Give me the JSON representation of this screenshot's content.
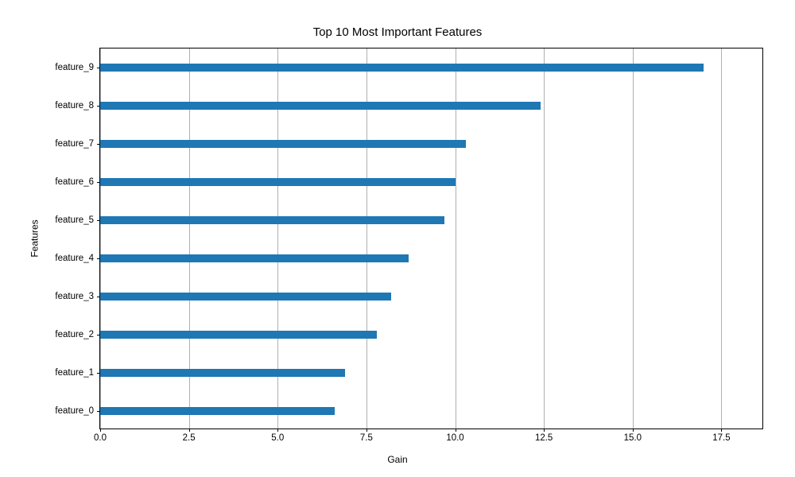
{
  "chart_data": {
    "type": "bar",
    "orientation": "horizontal",
    "title": "Top 10 Most Important Features",
    "xlabel": "Gain",
    "ylabel": "Features",
    "categories": [
      "feature_0",
      "feature_1",
      "feature_2",
      "feature_3",
      "feature_4",
      "feature_5",
      "feature_6",
      "feature_7",
      "feature_8",
      "feature_9"
    ],
    "values": [
      6.6,
      6.9,
      7.8,
      8.2,
      8.7,
      9.7,
      10.0,
      10.3,
      12.4,
      17.0
    ],
    "xlim": [
      0,
      18.7
    ],
    "xticks": [
      0.0,
      2.5,
      5.0,
      7.5,
      10.0,
      12.5,
      15.0,
      17.5
    ],
    "bar_color": "#1f77b4"
  }
}
